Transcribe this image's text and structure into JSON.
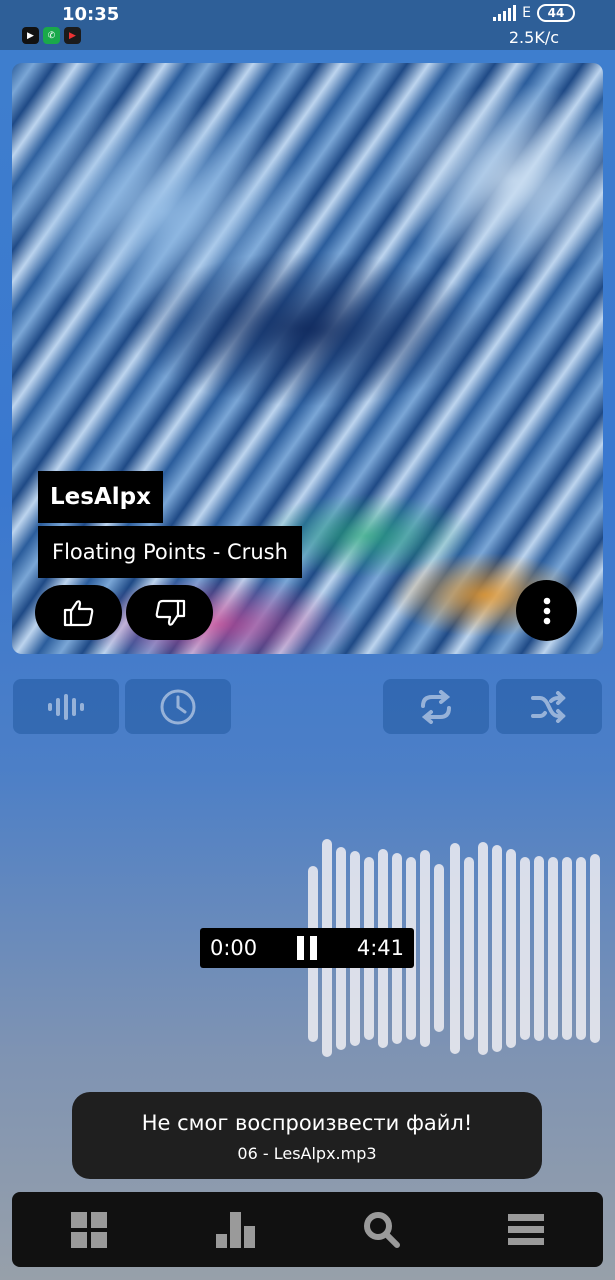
{
  "status_bar": {
    "time": "10:35",
    "network": "E",
    "battery": "44",
    "speed": "2.5K/c"
  },
  "player": {
    "artist": "LesAlpx",
    "track": "Floating Points - Crush",
    "current_time": "0:00",
    "total_time": "4:41"
  },
  "toast": {
    "title": "Не смог воспроизвести файл!",
    "subtitle": "06 - LesAlpx.mp3"
  },
  "icons": {
    "like": "thumbs-up-icon",
    "dislike": "thumbs-down-icon",
    "more": "more-vertical-icon",
    "visualizer": "waveform-icon",
    "history": "clock-icon",
    "repeat": "repeat-icon",
    "shuffle": "shuffle-icon",
    "nav": [
      "grid-icon",
      "bar-chart-icon",
      "search-icon",
      "menu-icon"
    ]
  },
  "colors": {
    "accent": "#3a78cf",
    "panel": "#000000",
    "toast": "#1f1f1f",
    "nav": "#111111"
  }
}
